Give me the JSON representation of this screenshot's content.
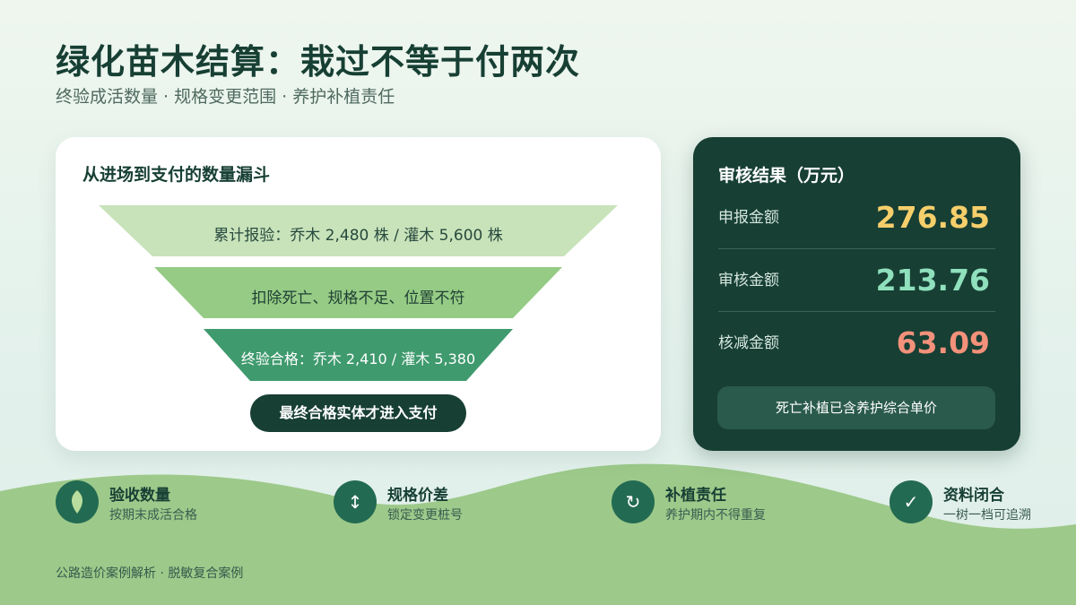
{
  "header": {
    "title": "绿化苗木结算：栽过不等于付两次",
    "subtitle": "终验成活数量 · 规格变更范围 · 养护补植责任"
  },
  "funnel_card": {
    "title": "从进场到支付的数量漏斗",
    "stages": [
      {
        "label": "累计报验：乔木 2,480 株 / 灌木 5,600 株",
        "color": "#c8e3ba"
      },
      {
        "label": "扣除死亡、规格不足、位置不符",
        "color": "#95cb85"
      },
      {
        "label": "终验合格：乔木 2,410 / 灌木 5,380",
        "color": "#3f9a6e"
      }
    ],
    "final_pill": "最终合格实体才进入支付"
  },
  "result_panel": {
    "title": "审核结果（万元）",
    "rows": [
      {
        "label": "申报金额",
        "value": "276.85",
        "color": "#f6cf6b"
      },
      {
        "label": "审核金额",
        "value": "213.76",
        "color": "#8fe0bd"
      },
      {
        "label": "核减金额",
        "value": "63.09",
        "color": "#f3917a"
      }
    ],
    "note_button": "死亡补植已含养护综合单价"
  },
  "features": [
    {
      "icon": "leaf-icon",
      "title": "验收数量",
      "sub": "按期末成活合格"
    },
    {
      "icon": "up-down-arrow-icon",
      "title": "规格价差",
      "sub": "锁定变更桩号"
    },
    {
      "icon": "refresh-icon",
      "title": "补植责任",
      "sub": "养护期内不得重复"
    },
    {
      "icon": "check-icon",
      "title": "资料闭合",
      "sub": "一树一档可追溯"
    }
  ],
  "footer": "公路造价案例解析 · 脱敏复合案例"
}
